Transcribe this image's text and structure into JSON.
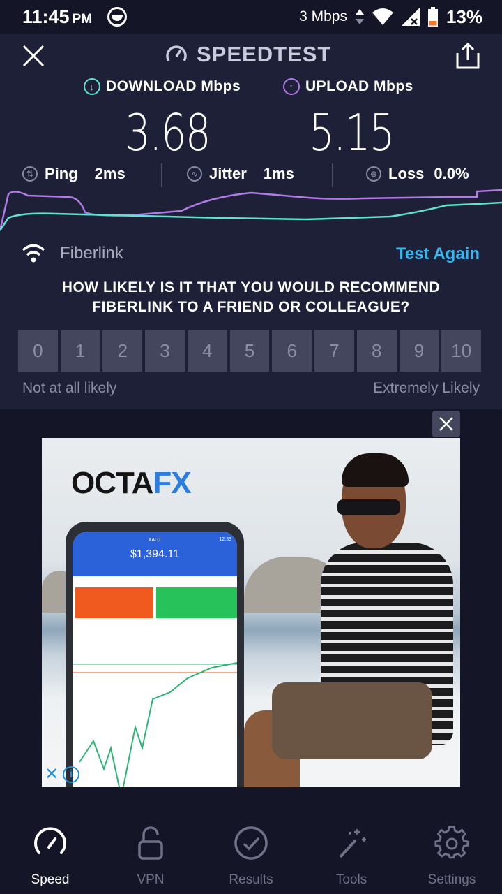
{
  "status_bar": {
    "time": "11:45",
    "ampm": "PM",
    "data_rate": "3 Mbps",
    "battery": "13%"
  },
  "header": {
    "brand": "SPEEDTEST"
  },
  "results": {
    "download_label": "DOWNLOAD Mbps",
    "download_value": "3.68",
    "upload_label": "UPLOAD Mbps",
    "upload_value": "5.15",
    "ping_label": "Ping",
    "ping_value": "2ms",
    "jitter_label": "Jitter",
    "jitter_value": "1ms",
    "loss_label": "Loss",
    "loss_value": "0.0%"
  },
  "colors": {
    "download": "#5ee3d2",
    "upload": "#b17ae6",
    "accent": "#3ab6ee"
  },
  "provider": {
    "name": "Fiberlink",
    "test_again": "Test Again"
  },
  "survey": {
    "question_line1": "HOW LIKELY IS IT THAT YOU WOULD RECOMMEND",
    "question_line2": "FIBERLINK TO A FRIEND OR COLLEAGUE?",
    "scale": [
      "0",
      "1",
      "2",
      "3",
      "4",
      "5",
      "6",
      "7",
      "8",
      "9",
      "10"
    ],
    "low_label": "Not at all likely",
    "high_label": "Extremely Likely"
  },
  "ad": {
    "brand_part1": "OCTA",
    "brand_part2": "FX",
    "balance": "$1,394.11",
    "phone_time": "12:33",
    "phone_sub": "XAUT",
    "badge": "✕"
  },
  "nav": {
    "items": [
      {
        "label": "Speed",
        "icon": "speedometer-icon"
      },
      {
        "label": "VPN",
        "icon": "lock-icon"
      },
      {
        "label": "Results",
        "icon": "check-circle-icon"
      },
      {
        "label": "Tools",
        "icon": "magic-wand-icon"
      },
      {
        "label": "Settings",
        "icon": "gear-icon"
      }
    ]
  }
}
